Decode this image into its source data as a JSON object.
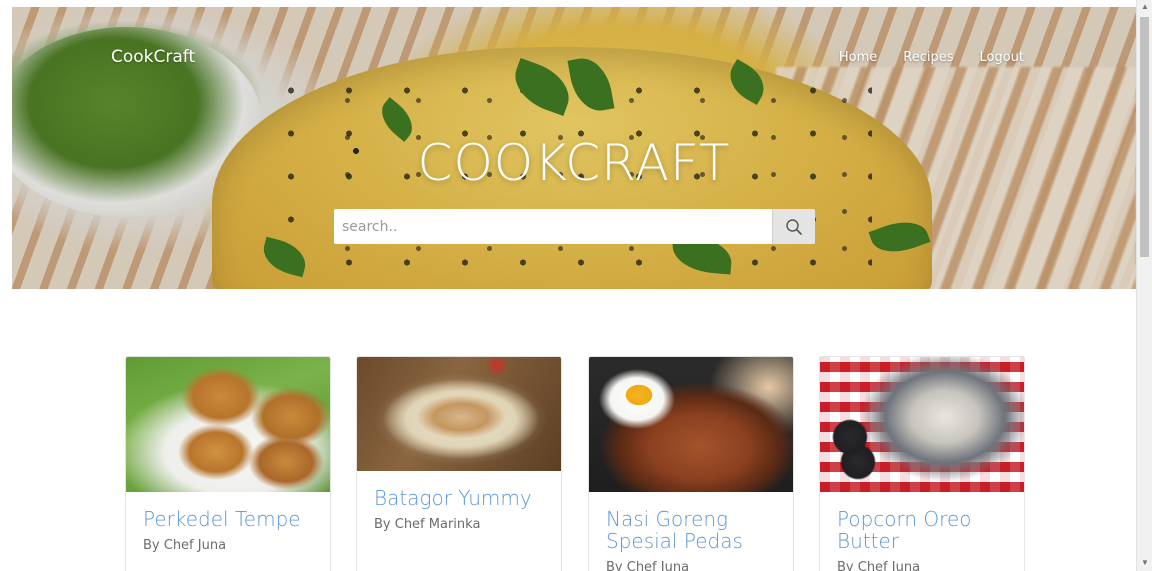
{
  "header": {
    "brand": "CookCraft",
    "nav": [
      "Home",
      "Recipes",
      "Logout"
    ],
    "hero_title": "COOKCRAFT"
  },
  "search": {
    "placeholder": "search..",
    "value": "",
    "icon": "search-icon"
  },
  "recipes": [
    {
      "title": "Perkedel Tempe",
      "author": "By Chef Juna",
      "image": "perkedel-image"
    },
    {
      "title": "Batagor Yummy",
      "author": "By Chef Marinka",
      "image": "batagor-image"
    },
    {
      "title": "Nasi Goreng Spesial Pedas",
      "author": "By Chef Juna",
      "image": "nasi-goreng-image"
    },
    {
      "title": "Popcorn Oreo Butter",
      "author": "By Chef Juna",
      "image": "popcorn-image"
    }
  ],
  "colors": {
    "link": "#5a95d8",
    "hero_text": "#ffffff",
    "search_button": "#e4e4e4"
  }
}
